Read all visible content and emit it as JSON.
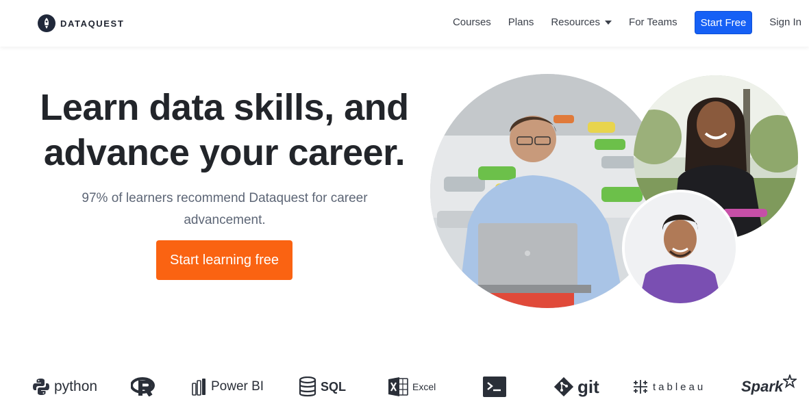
{
  "brand": {
    "name": "DATAQUEST"
  },
  "nav": {
    "courses": "Courses",
    "plans": "Plans",
    "resources": "Resources",
    "for_teams": "For Teams",
    "start_free": "Start Free",
    "sign_in": "Sign In"
  },
  "hero": {
    "title_line1": "Learn data skills, and",
    "title_line2": "advance your career.",
    "subtitle": "97% of learners recommend Dataquest for career advancement.",
    "cta": "Start learning free"
  },
  "photos": [
    "classroom-student-photo",
    "smiling-woman-photo",
    "smiling-man-photo"
  ],
  "technologies": [
    {
      "name": "python",
      "icon": "python-icon"
    },
    {
      "name": "R",
      "icon": "r-icon"
    },
    {
      "name": "Power BI",
      "icon": "power-bi-icon"
    },
    {
      "name": "SQL",
      "icon": "sql-icon"
    },
    {
      "name": "Excel",
      "icon": "excel-icon"
    },
    {
      "name": "Command Line",
      "icon": "terminal-icon"
    },
    {
      "name": "git",
      "icon": "git-icon"
    },
    {
      "name": "tableau",
      "icon": "tableau-icon"
    },
    {
      "name": "Spark",
      "icon": "spark-icon"
    }
  ],
  "colors": {
    "accent_blue": "#1660f5",
    "cta_orange": "#fa6312",
    "heading": "#22252a",
    "body_text": "#5d6676"
  }
}
